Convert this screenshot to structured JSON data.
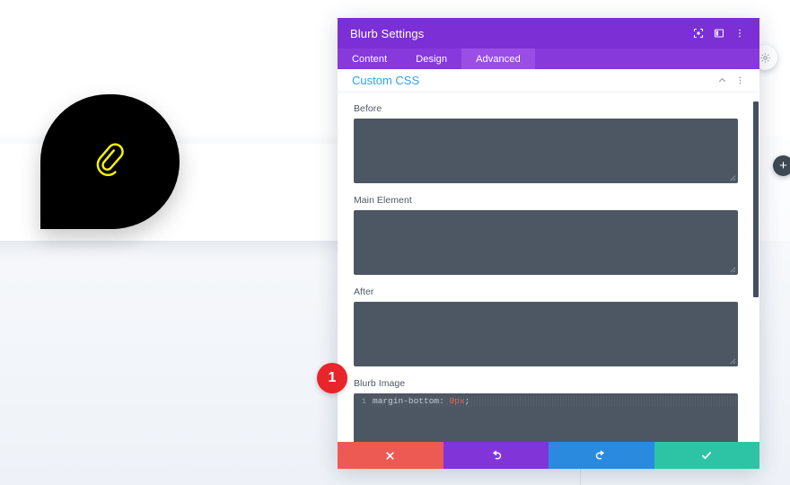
{
  "canvas": {
    "blurb_icon": "paperclip-icon",
    "blurb_icon_color": "#f5f008",
    "blurb_blob_color": "#000000",
    "gear_fab_icon": "gear-icon",
    "add_fab_label": "+"
  },
  "modal": {
    "title": "Blurb Settings",
    "titlebar_icons": [
      {
        "name": "fullscreen-icon",
        "glyph": "expand"
      },
      {
        "name": "layout-view-icon",
        "glyph": "split"
      },
      {
        "name": "more-options-icon",
        "glyph": "dots"
      }
    ],
    "tabs": [
      {
        "label": "Content",
        "active": false
      },
      {
        "label": "Design",
        "active": false
      },
      {
        "label": "Advanced",
        "active": true
      }
    ],
    "section": {
      "title": "Custom CSS",
      "collapse_icon": "chevron-up-icon",
      "menu_icon": "more-options-icon"
    },
    "fields": [
      {
        "label": "Before",
        "type": "textarea",
        "value": ""
      },
      {
        "label": "Main Element",
        "type": "textarea",
        "value": ""
      },
      {
        "label": "After",
        "type": "textarea",
        "value": ""
      },
      {
        "label": "Blurb Image",
        "type": "code",
        "line_number": "1",
        "code_property": "margin-bottom:",
        "code_value": " 0px",
        "code_punct": ";"
      }
    ],
    "footer": [
      {
        "name": "cancel-button",
        "icon": "close-icon",
        "glyph": "✖",
        "color": "#ed5a53"
      },
      {
        "name": "undo-button",
        "icon": "undo-icon",
        "glyph": "↺",
        "color": "#8134d8"
      },
      {
        "name": "redo-button",
        "icon": "redo-icon",
        "glyph": "↻",
        "color": "#2a8ade"
      },
      {
        "name": "save-button",
        "icon": "check-icon",
        "glyph": "✔",
        "color": "#2dc4a6"
      }
    ]
  },
  "annotation": {
    "step_number": "1"
  }
}
